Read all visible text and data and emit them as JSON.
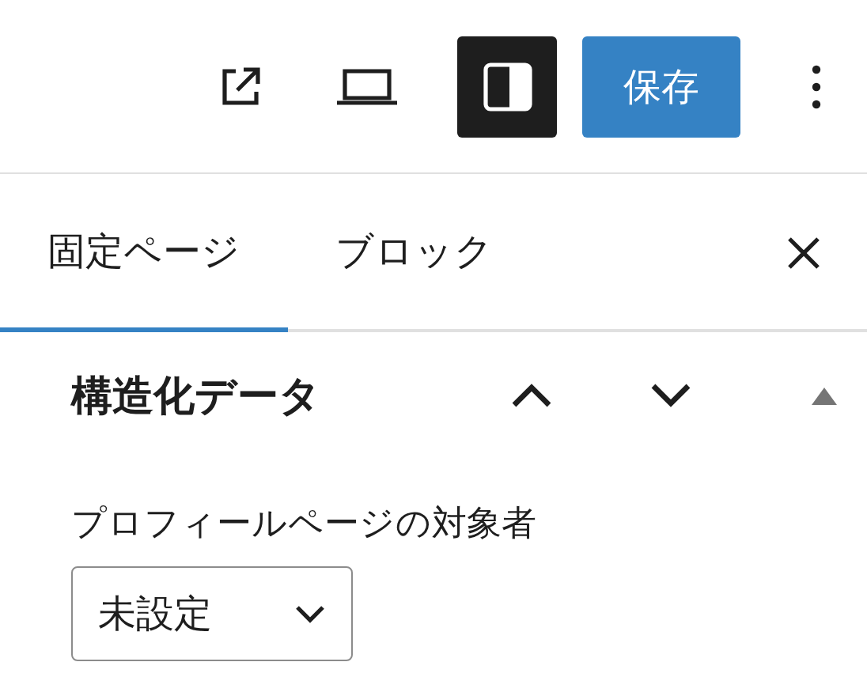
{
  "toolbar": {
    "sidebar_toggle": {
      "pressed": true
    },
    "save_button": {
      "label": "保存"
    }
  },
  "tabs": [
    {
      "label": "固定ページ",
      "selected": true
    },
    {
      "label": "ブロック",
      "selected": false
    }
  ],
  "panel": {
    "title": "構造化データ",
    "expanded": true,
    "field": {
      "label": "プロフィールページの対象者",
      "value": "未設定"
    }
  }
}
